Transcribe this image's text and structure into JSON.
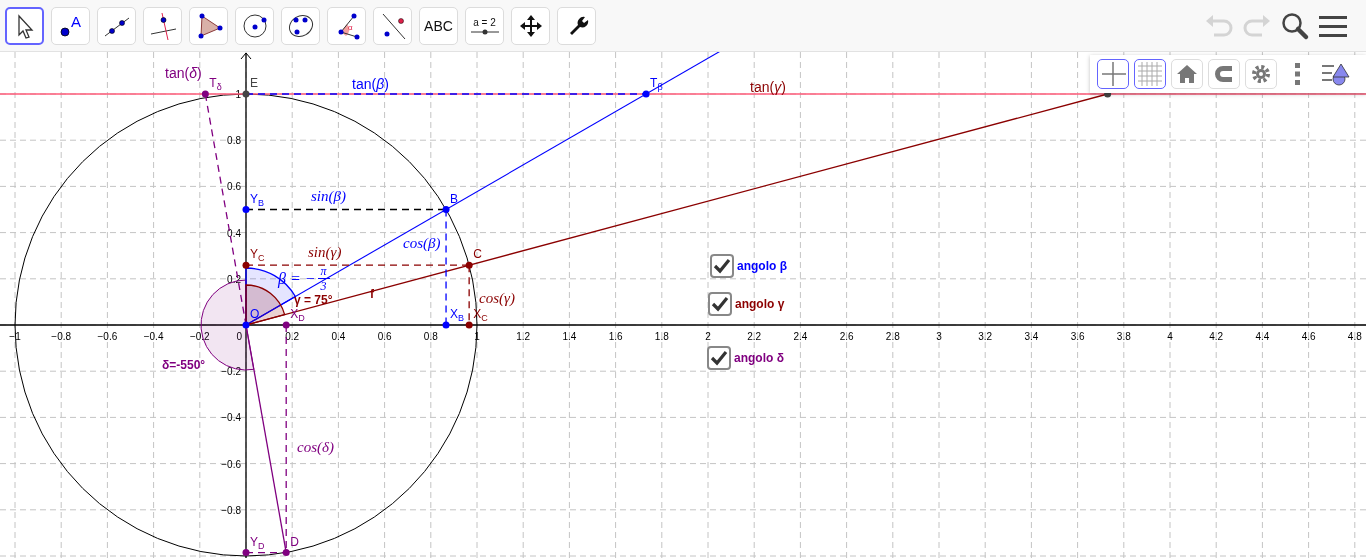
{
  "toolbar": {
    "tools": [
      {
        "kind": "select",
        "selected": true
      },
      {
        "kind": "point",
        "label": "A",
        "selected": false
      },
      {
        "kind": "line",
        "selected": false
      },
      {
        "kind": "perpendicular",
        "selected": false
      },
      {
        "kind": "polygon",
        "selected": false
      },
      {
        "kind": "circle",
        "selected": false
      },
      {
        "kind": "ellipse",
        "selected": false
      },
      {
        "kind": "angle",
        "label": "α",
        "selected": false
      },
      {
        "kind": "reflect",
        "selected": false
      },
      {
        "kind": "text",
        "label": "ABC",
        "selected": false
      },
      {
        "kind": "slider",
        "label": "a = 2",
        "selected": false
      },
      {
        "kind": "move-view",
        "selected": false
      },
      {
        "kind": "tools",
        "selected": false
      }
    ],
    "actions": [
      {
        "kind": "undo",
        "disabled": true
      },
      {
        "kind": "redo",
        "disabled": true
      },
      {
        "kind": "search",
        "disabled": false
      },
      {
        "kind": "menu",
        "disabled": false
      }
    ]
  },
  "style_bar": [
    {
      "kind": "axes",
      "on": true
    },
    {
      "kind": "grid",
      "on": true
    },
    {
      "kind": "home",
      "on": false
    },
    {
      "kind": "snap",
      "on": false
    },
    {
      "kind": "settings",
      "on": false
    },
    {
      "kind": "more"
    },
    {
      "kind": "style-toggle"
    }
  ],
  "axes": {
    "x_labels": [
      "−1",
      "−0.8",
      "−0.6",
      "−0.4",
      "−0.2",
      "0",
      "0.2",
      "0.4",
      "0.6",
      "0.8",
      "1",
      "1.2",
      "1.4",
      "1.6",
      "1.8",
      "2",
      "2.2",
      "2.4",
      "2.6",
      "2.8",
      "3",
      "3.2",
      "3.4",
      "3.6",
      "3.8",
      "4",
      "4.2",
      "4.4",
      "4.6",
      "4.8"
    ],
    "y_labels": [
      "1",
      "0.8",
      "0.6",
      "0.4",
      "0.2",
      "−0.2",
      "−0.4",
      "−0.6",
      "−0.8"
    ]
  },
  "points": [
    {
      "label": "T$_{δ}$",
      "color": "#800080"
    },
    {
      "label": "E",
      "color": "#444444"
    },
    {
      "label": "T$_{β}$",
      "color": "#0000ff"
    },
    {
      "color": "#444444"
    },
    {
      "label": "Y$_{B}$",
      "color": "#0000ff"
    },
    {
      "label": "B",
      "color": "#0000ff"
    },
    {
      "label": "Y$_{C}$",
      "color": "#8b0000"
    },
    {
      "label": "C",
      "color": "#8b0000"
    },
    {
      "label": "O",
      "color": "#0000ff"
    },
    {
      "label": "X$_{D}$",
      "color": "#800080"
    },
    {
      "label": "X$_{B}$",
      "color": "#0000ff"
    },
    {
      "label": "X$_{C}$",
      "color": "#8b0000"
    },
    {
      "label": "Y$_{D}$",
      "color": "#800080"
    },
    {
      "label": "D",
      "color": "#800080"
    }
  ],
  "captions": [
    {
      "text": "tan(*δ*)",
      "kind": "text",
      "color": "#800080"
    },
    {
      "text": "tan(*β*)",
      "kind": "text",
      "color": "#0000ff"
    },
    {
      "text": "tan(*γ*)",
      "kind": "text",
      "color": "#8b0000"
    },
    {
      "text": "sin(β)",
      "kind": "math",
      "color": "#0000ff"
    },
    {
      "text": "cos(β)",
      "kind": "math",
      "color": "#0000ff"
    },
    {
      "text": "sin(γ)",
      "kind": "math",
      "color": "#8b0000"
    },
    {
      "text": "γ = 75°",
      "kind": "small",
      "color": "#8b0000"
    },
    {
      "text": "f",
      "kind": "small",
      "color": "#8b0000"
    },
    {
      "text": "cos(γ)",
      "kind": "math",
      "color": "#8b0000"
    },
    {
      "text": "δ=-550°",
      "kind": "small",
      "color": "#800080"
    },
    {
      "text": "cos(δ)",
      "kind": "math",
      "color": "#800080"
    }
  ],
  "beta_label": {
    "lhs": "β = −",
    "numerator": "π",
    "denominator": "3"
  },
  "checkboxes": [
    {
      "label": "angolo β",
      "color": "#0000ff",
      "checked": true
    },
    {
      "label": "angolo γ",
      "color": "#8b0000",
      "checked": true
    },
    {
      "label": "angolo δ",
      "color": "#800080",
      "checked": true
    }
  ]
}
